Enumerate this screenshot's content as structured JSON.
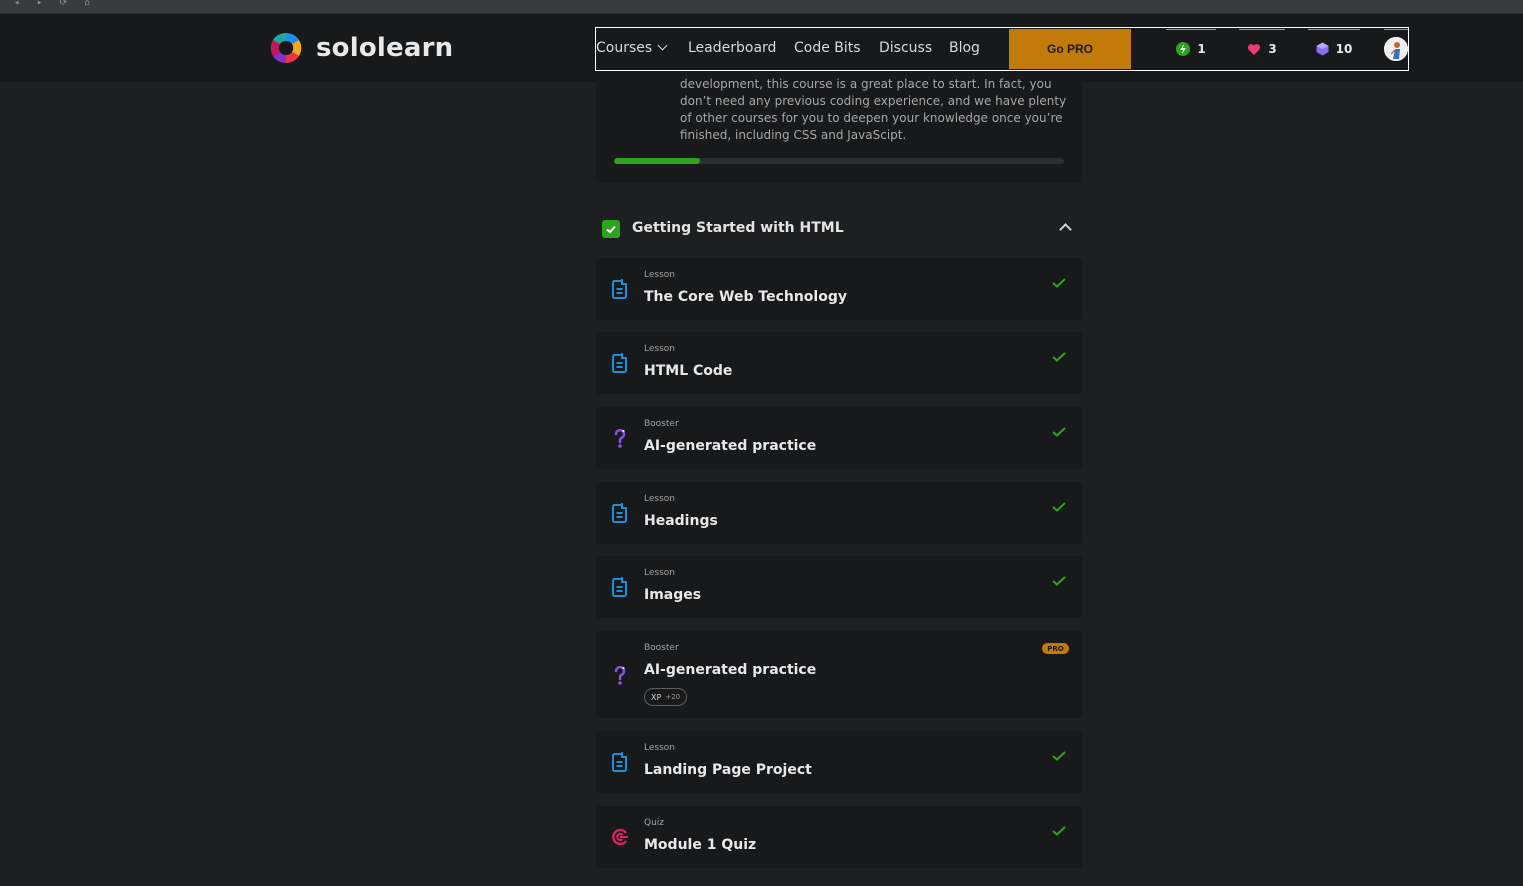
{
  "brand": {
    "name": "sololearn"
  },
  "nav": {
    "courses": "Courses",
    "leaderboard": "Leaderboard",
    "code_bits": "Code Bits",
    "discuss": "Discuss",
    "blog": "Blog",
    "go_pro": "Go PRO"
  },
  "stats": {
    "streak": "1",
    "hearts": "3",
    "gems": "10"
  },
  "course": {
    "description_partial": "development, this course is a great place to start. In fact, you don’t need any previous coding experience, and we have plenty of other courses for you to deepen your knowledge once you’re finished, including CSS and JavaScipt.",
    "progress_fraction": 0.19
  },
  "module": {
    "title": "Getting Started with HTML",
    "completed": true,
    "expanded": true
  },
  "items": [
    {
      "type": "Lesson",
      "title": "The Core Web Technology",
      "kind": "lesson",
      "done": true
    },
    {
      "type": "Lesson",
      "title": "HTML Code",
      "kind": "lesson",
      "done": true
    },
    {
      "type": "Booster",
      "title": "AI-generated practice",
      "kind": "booster",
      "done": true
    },
    {
      "type": "Lesson",
      "title": "Headings",
      "kind": "lesson",
      "done": true
    },
    {
      "type": "Lesson",
      "title": "Images",
      "kind": "lesson",
      "done": true
    },
    {
      "type": "Booster",
      "title": "AI-generated practice",
      "kind": "booster",
      "done": false,
      "badge": "PRO",
      "xp_label": "XP",
      "xp_value": "+20"
    },
    {
      "type": "Lesson",
      "title": "Landing Page Project",
      "kind": "lesson",
      "done": true
    },
    {
      "type": "Quiz",
      "title": "Module 1 Quiz",
      "kind": "quiz",
      "done": true
    }
  ],
  "colors": {
    "accent_green": "#2ea31f",
    "pro_orange": "#c27a0a",
    "lesson_blue": "#1e8fd6",
    "booster_purple": "#8a4fe0",
    "quiz_red": "#d8245a"
  }
}
